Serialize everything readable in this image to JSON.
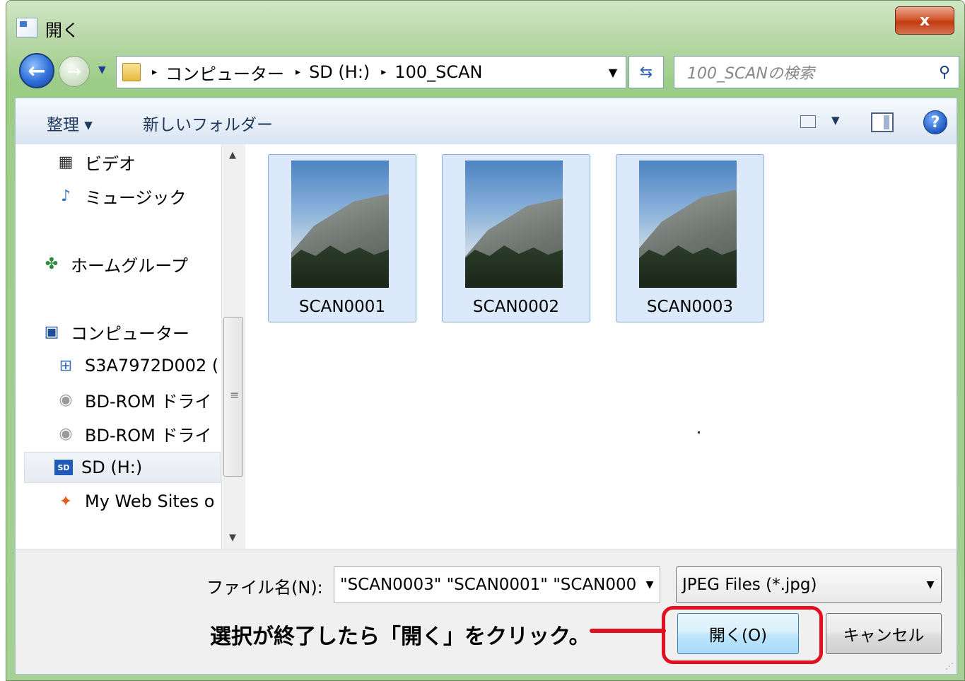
{
  "window": {
    "title": "開く",
    "close_label": "x"
  },
  "address": {
    "crumbs": [
      "コンピューター",
      "SD (H:)",
      "100_SCAN"
    ],
    "separator": "▸"
  },
  "search": {
    "placeholder": "100_SCANの検索"
  },
  "toolbar": {
    "organize": "整理 ▾",
    "new_folder": "新しいフォルダー"
  },
  "nav": {
    "items": [
      {
        "label": "ビデオ",
        "icon": "film-icon"
      },
      {
        "label": "ミュージック",
        "icon": "music-note-icon"
      },
      {
        "label": "ホームグループ",
        "icon": "homegroup-icon"
      },
      {
        "label": "コンピューター",
        "icon": "computer-icon"
      },
      {
        "label": "S3A7972D002 (",
        "icon": "windows-drive-icon"
      },
      {
        "label": "BD-ROM ドライ",
        "icon": "disc-icon"
      },
      {
        "label": "BD-ROM ドライ",
        "icon": "disc-icon"
      },
      {
        "label": "SD (H:)",
        "icon": "sd-card-icon",
        "selected": true
      },
      {
        "label": "My Web Sites o",
        "icon": "web-sites-icon"
      }
    ]
  },
  "files": [
    {
      "name": "SCAN0001"
    },
    {
      "name": "SCAN0002"
    },
    {
      "name": "SCAN0003"
    }
  ],
  "bottom": {
    "filename_label": "ファイル名(N):",
    "filename_value": "\"SCAN0003\" \"SCAN0001\" \"SCAN000",
    "filetype_value": "JPEG Files (*.jpg)",
    "open_label": "開く(O)",
    "cancel_label": "キャンセル"
  },
  "annotation": {
    "instruction": "選択が終了したら「開く」をクリック。",
    "color": "#e10f1f"
  }
}
